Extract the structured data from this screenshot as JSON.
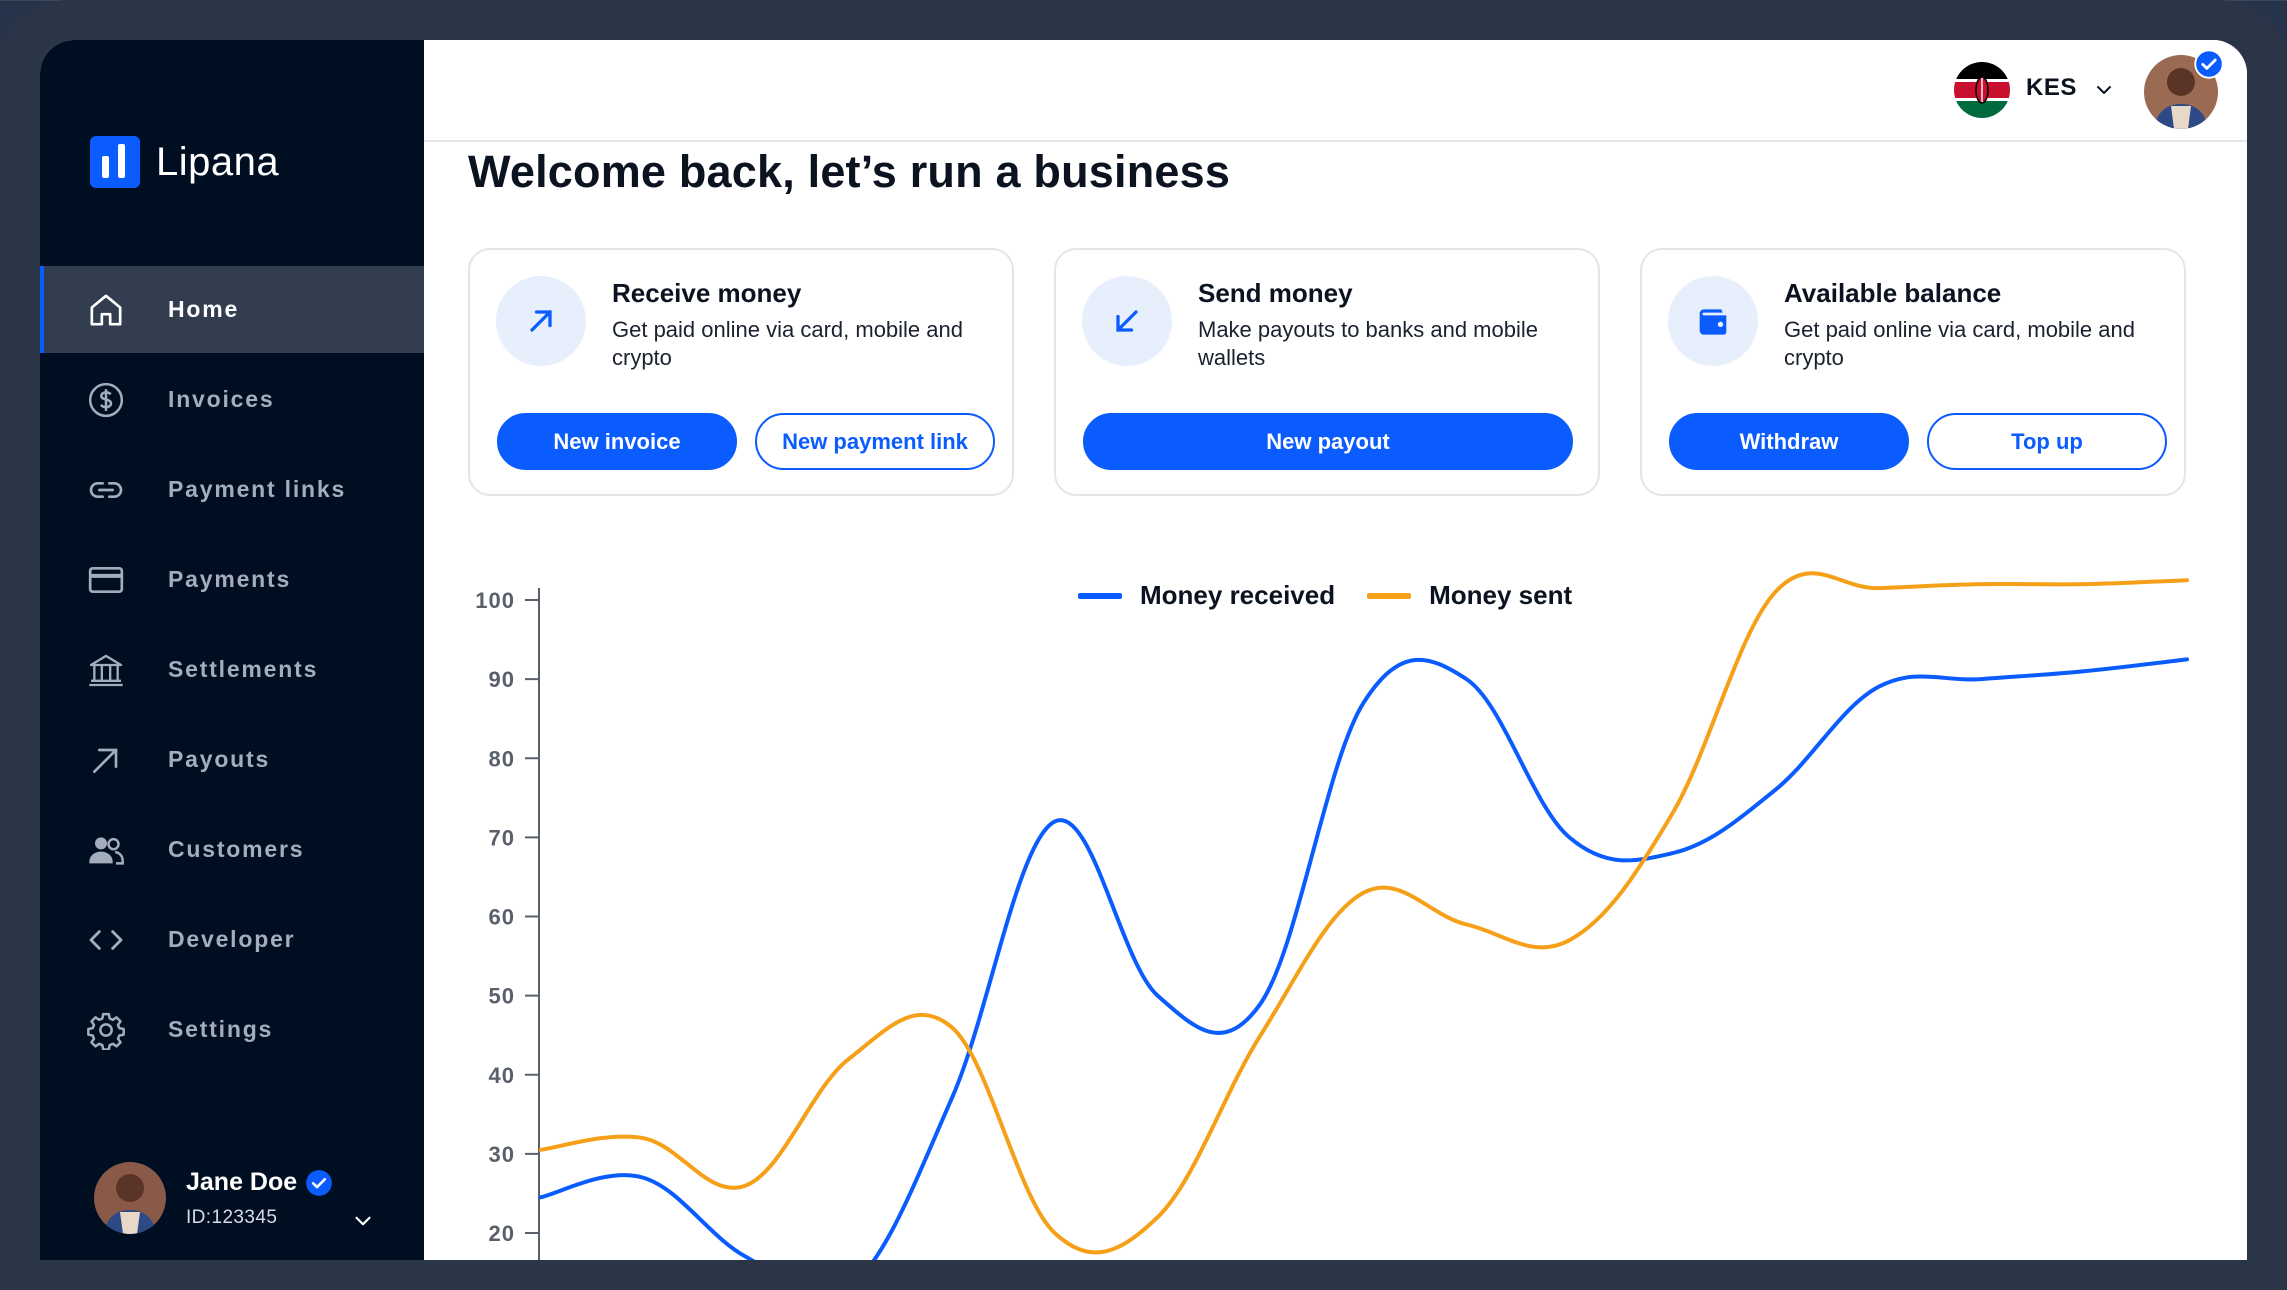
{
  "app": {
    "name": "Lipana"
  },
  "sidebar": {
    "items": [
      {
        "label": "Home",
        "icon": "home-icon",
        "active": true
      },
      {
        "label": "Invoices",
        "icon": "dollar-circle-icon"
      },
      {
        "label": "Payment links",
        "icon": "link-icon"
      },
      {
        "label": "Payments",
        "icon": "credit-card-icon"
      },
      {
        "label": "Settlements",
        "icon": "bank-icon"
      },
      {
        "label": "Payouts",
        "icon": "arrow-up-right-icon"
      },
      {
        "label": "Customers",
        "icon": "users-icon"
      },
      {
        "label": "Developer",
        "icon": "code-icon"
      },
      {
        "label": "Settings",
        "icon": "gear-icon"
      }
    ],
    "user": {
      "name": "Jane Doe",
      "id": "ID:123345"
    }
  },
  "topbar": {
    "currency": "KES"
  },
  "main": {
    "title": "Welcome back, let’s run a business",
    "cards": [
      {
        "title": "Receive money",
        "description": "Get paid online via card, mobile and crypto",
        "buttons": [
          "New invoice",
          "New payment link"
        ]
      },
      {
        "title": "Send money",
        "description": "Make payouts to banks and mobile wallets",
        "buttons": [
          "New payout"
        ]
      },
      {
        "title": "Available balance",
        "description": "Get paid online via card, mobile and crypto",
        "buttons": [
          "Withdraw",
          "Top up"
        ]
      }
    ]
  },
  "colors": {
    "accent": "#0b5cff",
    "sidebar_bg": "#000e22",
    "money_sent": "#f5a018",
    "money_received": "#0b5cff"
  },
  "chart_data": {
    "type": "line",
    "title": "",
    "xlabel": "",
    "ylabel": "",
    "ylim": [
      20,
      100
    ],
    "yticks": [
      "100",
      "90",
      "80",
      "70",
      "60",
      "50",
      "40",
      "30",
      "20"
    ],
    "x": [
      0,
      1,
      2,
      3,
      4,
      5,
      6,
      7,
      8,
      9,
      10,
      11,
      12,
      13,
      14,
      15,
      16
    ],
    "legend_position": "top-center",
    "series": [
      {
        "name": "Money received",
        "color": "#0b5cff",
        "values": [
          24.5,
          27,
          17,
          13,
          37,
          72,
          50,
          49,
          87,
          90,
          70,
          68,
          76,
          89,
          90,
          91,
          92.5
        ]
      },
      {
        "name": "Money sent",
        "color": "#f5a018",
        "values": [
          30.5,
          32,
          26,
          42,
          46,
          20,
          22,
          45,
          63,
          59,
          57,
          73,
          101,
          101.5,
          102,
          102,
          102.5
        ]
      }
    ]
  }
}
